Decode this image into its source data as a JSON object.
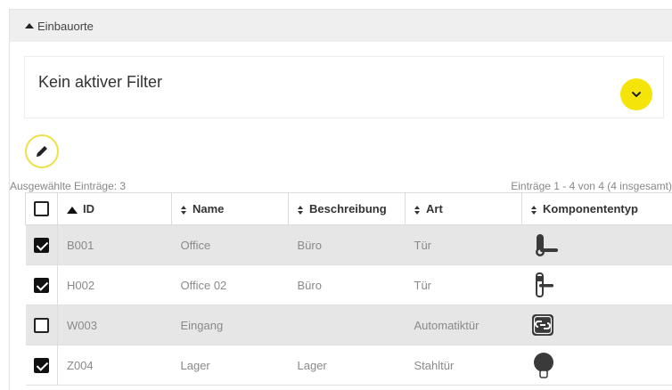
{
  "section": {
    "title": "Einbauorte"
  },
  "filter": {
    "label": "Kein aktiver Filter"
  },
  "meta": {
    "selected": "Ausgewählte Einträge: 3",
    "range": "Einträge 1 - 4 von 4 (4 insgesamt)"
  },
  "table": {
    "columns": [
      "ID",
      "Name",
      "Beschreibung",
      "Art",
      "Komponententyp"
    ],
    "rows": [
      {
        "checked": true,
        "id": "B001",
        "name": "Office",
        "beschreibung": "Büro",
        "art": "Tür",
        "component": "handle-lever-icon"
      },
      {
        "checked": true,
        "id": "H002",
        "name": "Office 02",
        "beschreibung": "Büro",
        "art": "Tür",
        "component": "handle-lever-plain-icon"
      },
      {
        "checked": false,
        "id": "W003",
        "name": "Eingang",
        "beschreibung": "",
        "art": "Automatiktür",
        "component": "link-module-icon"
      },
      {
        "checked": true,
        "id": "Z004",
        "name": "Lager",
        "beschreibung": "Lager",
        "art": "Stahltür",
        "component": "cylinder-knob-icon"
      }
    ]
  },
  "colors": {
    "accent": "#f5e40a",
    "row_selected": "#e6e6e6"
  }
}
